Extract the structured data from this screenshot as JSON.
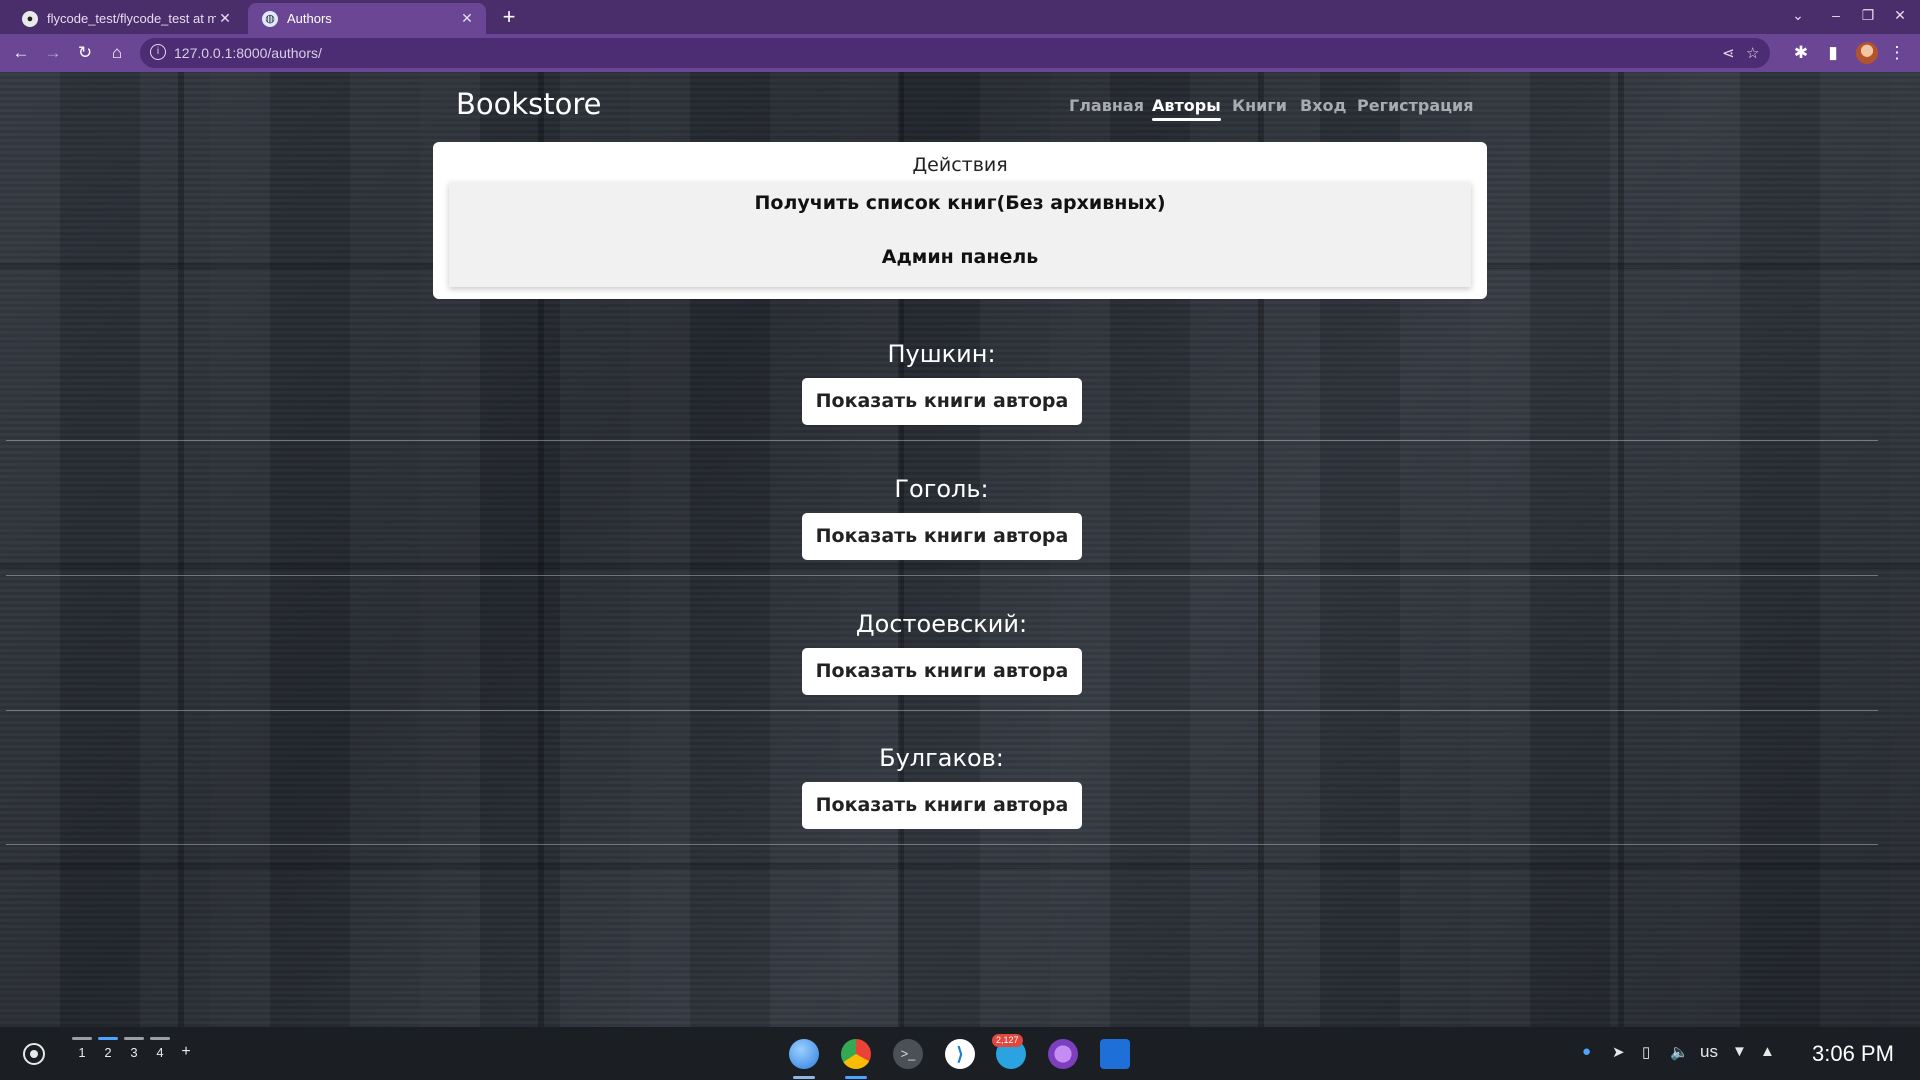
{
  "browser": {
    "tabs": [
      {
        "title": "flycode_test/flycode_test at m",
        "active": false
      },
      {
        "title": "Authors",
        "active": true
      }
    ],
    "url": "127.0.0.1:8000/authors/"
  },
  "navbar": {
    "brand": "Bookstore",
    "links": [
      {
        "label": "Главная",
        "active": false
      },
      {
        "label": "Авторы",
        "active": true
      },
      {
        "label": "Книги",
        "active": false
      },
      {
        "label": "Вход",
        "active": false
      },
      {
        "label": "Регистрация",
        "active": false
      }
    ]
  },
  "actions": {
    "title": "Действия",
    "items": [
      "Получить список книг(Без архивных)",
      "Админ панель"
    ]
  },
  "authors": [
    {
      "name": "Пушкин:",
      "button": "Показать книги автора"
    },
    {
      "name": "Гоголь:",
      "button": "Показать книги автора"
    },
    {
      "name": "Достоевский:",
      "button": "Показать книги автора"
    },
    {
      "name": "Булгаков:",
      "button": "Показать книги автора"
    }
  ],
  "taskbar": {
    "desks": [
      "1",
      "2",
      "3",
      "4"
    ],
    "add_desk": "+",
    "notification_badge": "2,127",
    "keyboard_layout": "us",
    "time": "3:06 PM"
  },
  "colors": {
    "browser_frame": "#4a2d6b",
    "browser_toolbar": "#6b4694",
    "active_nav": "#ffffff",
    "inactive_nav": "#a8abb2"
  }
}
